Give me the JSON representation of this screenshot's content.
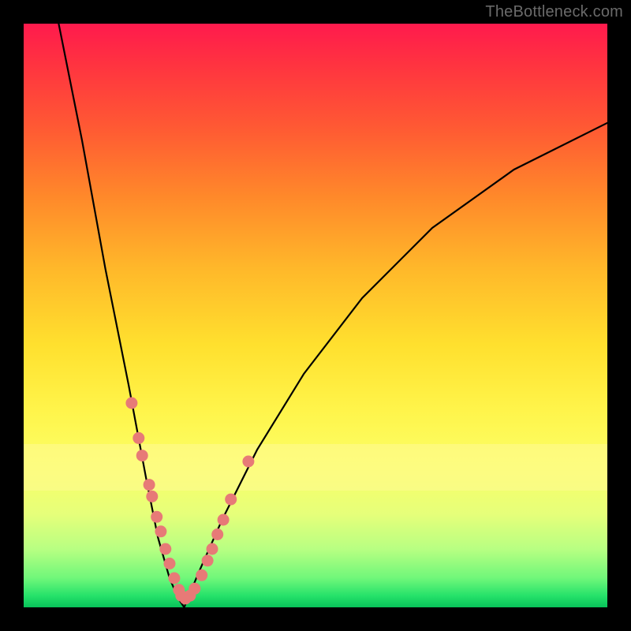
{
  "watermark": "TheBottleneck.com",
  "colors": {
    "frame": "#000000",
    "curve": "#000000",
    "dot": "#e77a77",
    "gradient_top": "#ff1a4d",
    "gradient_bottom": "#08c35a"
  },
  "chart_data": {
    "type": "line",
    "title": "",
    "xlabel": "",
    "ylabel": "",
    "xlim": [
      0,
      100
    ],
    "ylim": [
      0,
      100
    ],
    "notes": "No numeric axes or tick labels are rendered; values are pixel-position estimates in a 0–100 normalized space (origin bottom-left). The curve is a V-shape whose minimum touches the bottom edge near x≈27. Pink dots cluster along the lower arms of the V.",
    "series": [
      {
        "name": "curve-left",
        "x": [
          6,
          10,
          14,
          18,
          21,
          23,
          25,
          26.5,
          27.5
        ],
        "y": [
          100,
          80,
          58,
          38,
          22,
          12,
          5,
          1.5,
          0
        ]
      },
      {
        "name": "curve-right",
        "x": [
          27.5,
          30,
          34,
          40,
          48,
          58,
          70,
          84,
          100
        ],
        "y": [
          0,
          6,
          15,
          27,
          40,
          53,
          65,
          75,
          83
        ]
      }
    ],
    "dots": [
      {
        "x": 18.5,
        "y": 35
      },
      {
        "x": 19.7,
        "y": 29
      },
      {
        "x": 20.3,
        "y": 26
      },
      {
        "x": 21.5,
        "y": 21
      },
      {
        "x": 22.0,
        "y": 19
      },
      {
        "x": 22.8,
        "y": 15.5
      },
      {
        "x": 23.5,
        "y": 13
      },
      {
        "x": 24.3,
        "y": 10
      },
      {
        "x": 25.0,
        "y": 7.5
      },
      {
        "x": 25.8,
        "y": 5
      },
      {
        "x": 26.6,
        "y": 3
      },
      {
        "x": 27.0,
        "y": 2
      },
      {
        "x": 27.7,
        "y": 1.5
      },
      {
        "x": 28.5,
        "y": 2
      },
      {
        "x": 29.3,
        "y": 3.2
      },
      {
        "x": 30.5,
        "y": 5.5
      },
      {
        "x": 31.5,
        "y": 8
      },
      {
        "x": 32.3,
        "y": 10
      },
      {
        "x": 33.2,
        "y": 12.5
      },
      {
        "x": 34.2,
        "y": 15
      },
      {
        "x": 35.5,
        "y": 18.5
      },
      {
        "x": 38.5,
        "y": 25
      }
    ],
    "yellow_band_y": [
      20,
      28
    ]
  }
}
